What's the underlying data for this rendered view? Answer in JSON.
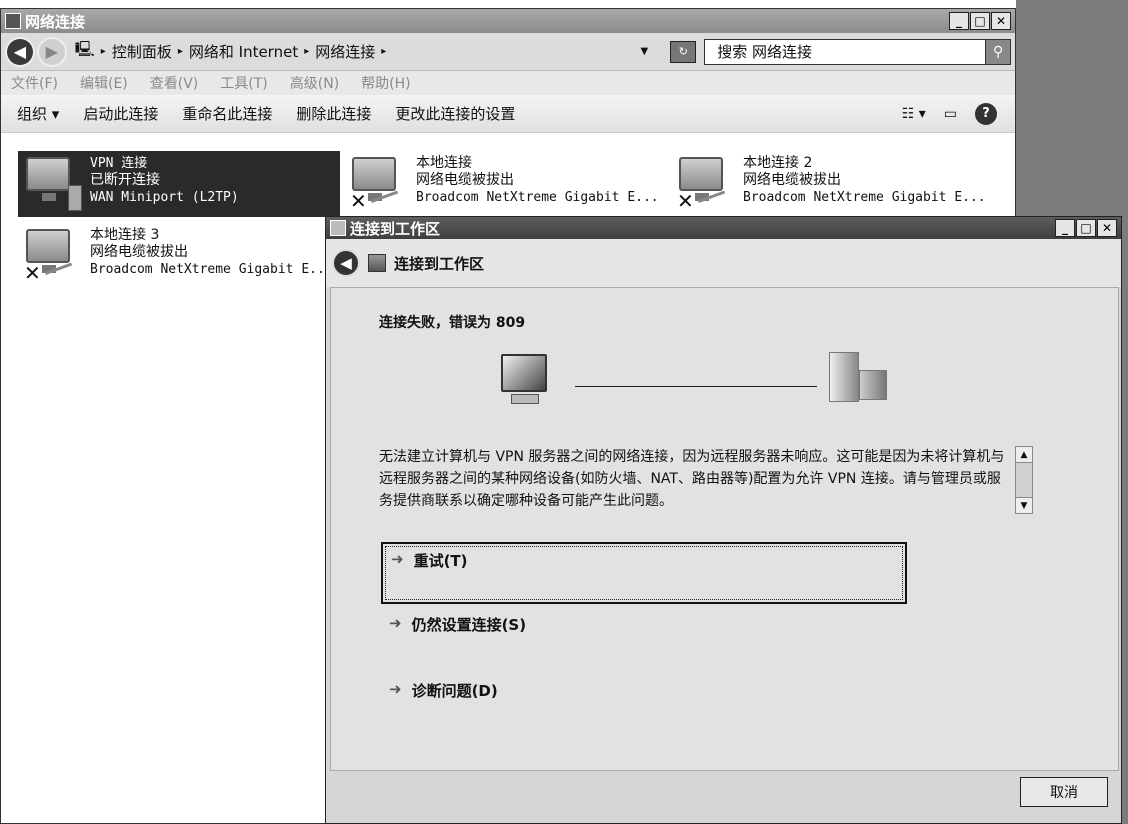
{
  "main_window": {
    "title": "网络连接",
    "breadcrumb": [
      "控制面板",
      "网络和 Internet",
      "网络连接"
    ],
    "search_placeholder": "搜索 网络连接",
    "menu": [
      "文件(F)",
      "编辑(E)",
      "查看(V)",
      "工具(T)",
      "高级(N)",
      "帮助(H)"
    ],
    "toolbar": {
      "organize": "组织 ▾",
      "start": "启动此连接",
      "rename": "重命名此连接",
      "delete": "删除此连接",
      "settings": "更改此连接的设置"
    },
    "connections": [
      {
        "name": "VPN 连接",
        "status": "已断开连接",
        "device": "WAN Miniport (L2TP)",
        "selected": true
      },
      {
        "name": "本地连接",
        "status": "网络电缆被拔出",
        "device": "Broadcom NetXtreme Gigabit E..."
      },
      {
        "name": "本地连接 2",
        "status": "网络电缆被拔出",
        "device": "Broadcom NetXtreme Gigabit E..."
      },
      {
        "name": "本地连接 3",
        "status": "网络电缆被拔出",
        "device": "Broadcom NetXtreme Gigabit E..."
      }
    ]
  },
  "dialog": {
    "title": "连接到工作区",
    "header": "连接到工作区",
    "error_title": "连接失败，错误为 809",
    "message": "无法建立计算机与 VPN 服务器之间的网络连接，因为远程服务器未响应。这可能是因为未将计算机与远程服务器之间的某种网络设备(如防火墙、NAT、路由器等)配置为允许 VPN 连接。请与管理员或服务提供商联系以确定哪种设备可能产生此问题。",
    "options": [
      "重试(T)",
      "仍然设置连接(S)",
      "诊断问题(D)"
    ],
    "cancel": "取消"
  }
}
